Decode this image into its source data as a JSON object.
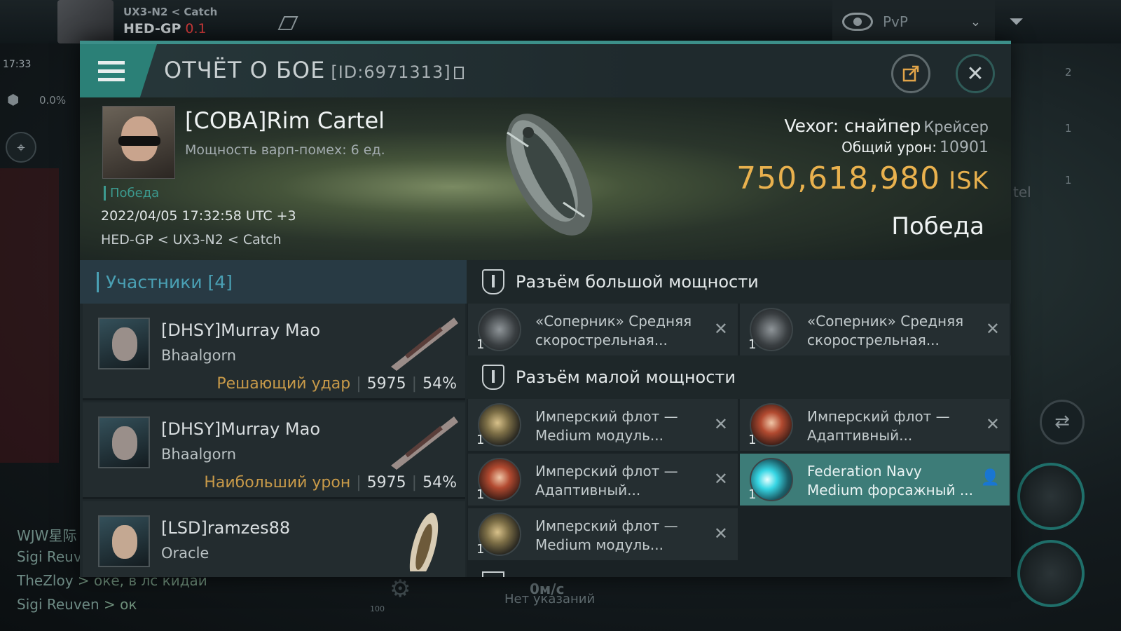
{
  "hud": {
    "loc_line1": "UX3-N2 < Catch",
    "loc_system": "HED-GP",
    "loc_sec": "0.1",
    "time": "17:33",
    "cargo_pct": "0.0%",
    "pvp_label": "PvP",
    "right_counts": [
      "2",
      "1",
      "1"
    ],
    "side_text": "tel",
    "chat": [
      {
        "name": "WJW星际",
        "text": ""
      },
      {
        "name": "Sigi Reuv",
        "text": ""
      },
      {
        "name": "TheZloy",
        "text": "> оке, в лс кидай"
      },
      {
        "name": "Sigi Reuven",
        "text": "> ок"
      }
    ],
    "speed": "0м/с",
    "no_orders": "Нет указаний",
    "scale": "100"
  },
  "report": {
    "title": "ОТЧЁТ О БОЕ",
    "id": "[ID:6971313]",
    "victim": {
      "name": "[COBA]Rim Cartel",
      "warp_strength": "Мощность варп-помех: 6 ед.",
      "tag": "Победа",
      "datetime": "2022/04/05 17:32:58 UTC +3",
      "route": "HED-GP < UX3-N2 < Catch"
    },
    "ship": {
      "name": "Vexor: снайпер",
      "class": "Крейсер",
      "damage_label": "Общий урон:",
      "damage_value": "10901",
      "isk_value": "750,618,980",
      "isk_unit": "ISK",
      "result": "Победа"
    },
    "participants": {
      "title": "Участники [4]",
      "rows": [
        {
          "name": "[DHSY]Murray Mao",
          "ship": "Bhaalgorn",
          "role": "Решающий удар",
          "damage": "5975",
          "percent": "54%"
        },
        {
          "name": "[DHSY]Murray Mao",
          "ship": "Bhaalgorn",
          "role": "Наибольший урон",
          "damage": "5975",
          "percent": "54%"
        },
        {
          "name": "[LSD]ramzes88",
          "ship": "Oracle",
          "role": "",
          "damage": "",
          "percent": ""
        }
      ]
    },
    "fitting": {
      "high_title": "Разъём большой мощности",
      "low_title": "Разъём малой мощности",
      "high": [
        {
          "qty": "1",
          "name": "«Соперник» Средняя скорострельная..."
        },
        {
          "qty": "1",
          "name": "«Соперник» Средняя скорострельная..."
        }
      ],
      "low": [
        {
          "qty": "1",
          "name": "Имперский флот — Medium модуль..."
        },
        {
          "qty": "1",
          "name": "Имперский флот — Адаптивный..."
        },
        {
          "qty": "1",
          "name": "Имперский флот — Адаптивный..."
        },
        {
          "qty": "1",
          "name": "Federation Navy Medium форсажный ..."
        },
        {
          "qty": "1",
          "name": "Имперский флот — Medium модуль..."
        }
      ]
    }
  },
  "colors": {
    "accent": "#3c8f89",
    "isk": "#e9b14e",
    "role": "#c89a49",
    "participants_header": "#4aa0b4",
    "highlight_module": "#3d7c78"
  }
}
